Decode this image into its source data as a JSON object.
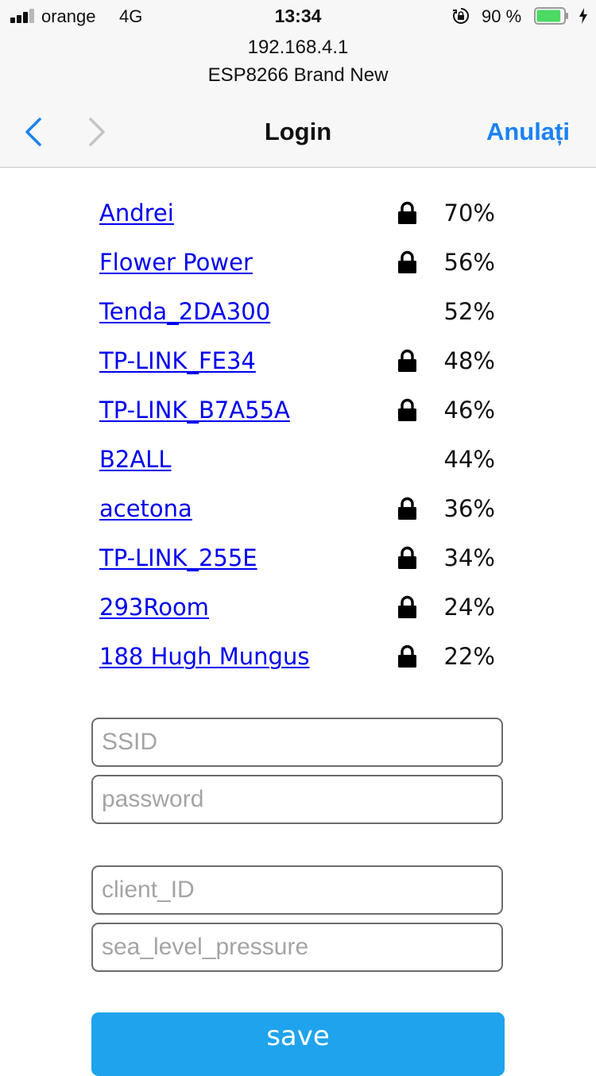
{
  "status_bar": {
    "carrier": "orange",
    "network": "4G",
    "time": "13:34",
    "battery_percent": "90 %",
    "battery_level": 0.9,
    "battery_color": "#4cd964",
    "icons": [
      "signal-icon",
      "rotation-lock-icon",
      "battery-icon",
      "charging-bolt-icon"
    ]
  },
  "header": {
    "host": "192.168.4.1",
    "subtitle": "ESP8266 Brand New",
    "title": "Login",
    "cancel_label": "Anulați",
    "accent_color": "#1a82f1"
  },
  "networks": [
    {
      "ssid": "Andrei",
      "signal": "70%",
      "locked": true
    },
    {
      "ssid": "Flower Power",
      "signal": "56%",
      "locked": true
    },
    {
      "ssid": "Tenda_2DA300",
      "signal": "52%",
      "locked": false
    },
    {
      "ssid": "TP-LINK_FE34",
      "signal": "48%",
      "locked": true
    },
    {
      "ssid": "TP-LINK_B7A55A",
      "signal": "46%",
      "locked": true
    },
    {
      "ssid": "B2ALL",
      "signal": "44%",
      "locked": false
    },
    {
      "ssid": "acetona",
      "signal": "36%",
      "locked": true
    },
    {
      "ssid": "TP-LINK_255E",
      "signal": "34%",
      "locked": true
    },
    {
      "ssid": "293Room",
      "signal": "24%",
      "locked": true
    },
    {
      "ssid": "188 Hugh Mungus",
      "signal": "22%",
      "locked": true
    }
  ],
  "form": {
    "ssid_placeholder": "SSID",
    "password_placeholder": "password",
    "client_id_placeholder": "client_ID",
    "sea_level_placeholder": "sea_level_pressure",
    "save_label": "save",
    "button_color": "#1fa3ec"
  }
}
